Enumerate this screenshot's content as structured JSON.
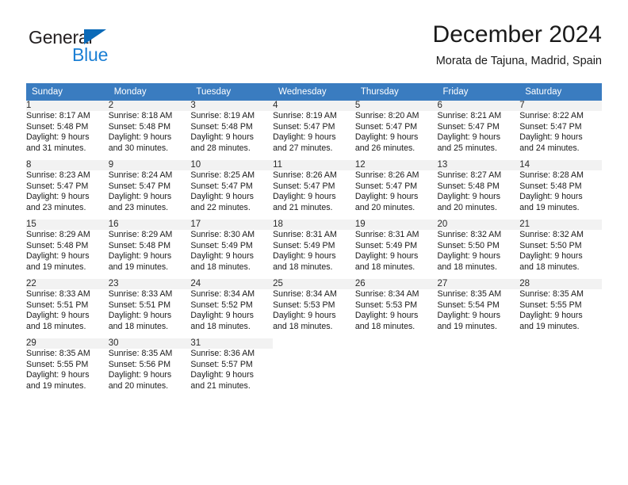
{
  "brand": {
    "name_part1": "General",
    "name_part2": "Blue",
    "triangle_color": "#0b6ab8",
    "blue_text_color": "#1b7fd4"
  },
  "header": {
    "title": "December 2024",
    "subtitle": "Morata de Tajuna, Madrid, Spain"
  },
  "theme": {
    "header_bg": "#3a7cc0",
    "header_text": "#ffffff",
    "daynum_bg": "#f2f2f2",
    "cell_bg": "#ffffff",
    "text": "#1a1a1a"
  },
  "calendar": {
    "weekday_headers": [
      "Sunday",
      "Monday",
      "Tuesday",
      "Wednesday",
      "Thursday",
      "Friday",
      "Saturday"
    ],
    "weeks": [
      [
        {
          "day": "1",
          "sunrise": "Sunrise: 8:17 AM",
          "sunset": "Sunset: 5:48 PM",
          "daylight1": "Daylight: 9 hours",
          "daylight2": "and 31 minutes."
        },
        {
          "day": "2",
          "sunrise": "Sunrise: 8:18 AM",
          "sunset": "Sunset: 5:48 PM",
          "daylight1": "Daylight: 9 hours",
          "daylight2": "and 30 minutes."
        },
        {
          "day": "3",
          "sunrise": "Sunrise: 8:19 AM",
          "sunset": "Sunset: 5:48 PM",
          "daylight1": "Daylight: 9 hours",
          "daylight2": "and 28 minutes."
        },
        {
          "day": "4",
          "sunrise": "Sunrise: 8:19 AM",
          "sunset": "Sunset: 5:47 PM",
          "daylight1": "Daylight: 9 hours",
          "daylight2": "and 27 minutes."
        },
        {
          "day": "5",
          "sunrise": "Sunrise: 8:20 AM",
          "sunset": "Sunset: 5:47 PM",
          "daylight1": "Daylight: 9 hours",
          "daylight2": "and 26 minutes."
        },
        {
          "day": "6",
          "sunrise": "Sunrise: 8:21 AM",
          "sunset": "Sunset: 5:47 PM",
          "daylight1": "Daylight: 9 hours",
          "daylight2": "and 25 minutes."
        },
        {
          "day": "7",
          "sunrise": "Sunrise: 8:22 AM",
          "sunset": "Sunset: 5:47 PM",
          "daylight1": "Daylight: 9 hours",
          "daylight2": "and 24 minutes."
        }
      ],
      [
        {
          "day": "8",
          "sunrise": "Sunrise: 8:23 AM",
          "sunset": "Sunset: 5:47 PM",
          "daylight1": "Daylight: 9 hours",
          "daylight2": "and 23 minutes."
        },
        {
          "day": "9",
          "sunrise": "Sunrise: 8:24 AM",
          "sunset": "Sunset: 5:47 PM",
          "daylight1": "Daylight: 9 hours",
          "daylight2": "and 23 minutes."
        },
        {
          "day": "10",
          "sunrise": "Sunrise: 8:25 AM",
          "sunset": "Sunset: 5:47 PM",
          "daylight1": "Daylight: 9 hours",
          "daylight2": "and 22 minutes."
        },
        {
          "day": "11",
          "sunrise": "Sunrise: 8:26 AM",
          "sunset": "Sunset: 5:47 PM",
          "daylight1": "Daylight: 9 hours",
          "daylight2": "and 21 minutes."
        },
        {
          "day": "12",
          "sunrise": "Sunrise: 8:26 AM",
          "sunset": "Sunset: 5:47 PM",
          "daylight1": "Daylight: 9 hours",
          "daylight2": "and 20 minutes."
        },
        {
          "day": "13",
          "sunrise": "Sunrise: 8:27 AM",
          "sunset": "Sunset: 5:48 PM",
          "daylight1": "Daylight: 9 hours",
          "daylight2": "and 20 minutes."
        },
        {
          "day": "14",
          "sunrise": "Sunrise: 8:28 AM",
          "sunset": "Sunset: 5:48 PM",
          "daylight1": "Daylight: 9 hours",
          "daylight2": "and 19 minutes."
        }
      ],
      [
        {
          "day": "15",
          "sunrise": "Sunrise: 8:29 AM",
          "sunset": "Sunset: 5:48 PM",
          "daylight1": "Daylight: 9 hours",
          "daylight2": "and 19 minutes."
        },
        {
          "day": "16",
          "sunrise": "Sunrise: 8:29 AM",
          "sunset": "Sunset: 5:48 PM",
          "daylight1": "Daylight: 9 hours",
          "daylight2": "and 19 minutes."
        },
        {
          "day": "17",
          "sunrise": "Sunrise: 8:30 AM",
          "sunset": "Sunset: 5:49 PM",
          "daylight1": "Daylight: 9 hours",
          "daylight2": "and 18 minutes."
        },
        {
          "day": "18",
          "sunrise": "Sunrise: 8:31 AM",
          "sunset": "Sunset: 5:49 PM",
          "daylight1": "Daylight: 9 hours",
          "daylight2": "and 18 minutes."
        },
        {
          "day": "19",
          "sunrise": "Sunrise: 8:31 AM",
          "sunset": "Sunset: 5:49 PM",
          "daylight1": "Daylight: 9 hours",
          "daylight2": "and 18 minutes."
        },
        {
          "day": "20",
          "sunrise": "Sunrise: 8:32 AM",
          "sunset": "Sunset: 5:50 PM",
          "daylight1": "Daylight: 9 hours",
          "daylight2": "and 18 minutes."
        },
        {
          "day": "21",
          "sunrise": "Sunrise: 8:32 AM",
          "sunset": "Sunset: 5:50 PM",
          "daylight1": "Daylight: 9 hours",
          "daylight2": "and 18 minutes."
        }
      ],
      [
        {
          "day": "22",
          "sunrise": "Sunrise: 8:33 AM",
          "sunset": "Sunset: 5:51 PM",
          "daylight1": "Daylight: 9 hours",
          "daylight2": "and 18 minutes."
        },
        {
          "day": "23",
          "sunrise": "Sunrise: 8:33 AM",
          "sunset": "Sunset: 5:51 PM",
          "daylight1": "Daylight: 9 hours",
          "daylight2": "and 18 minutes."
        },
        {
          "day": "24",
          "sunrise": "Sunrise: 8:34 AM",
          "sunset": "Sunset: 5:52 PM",
          "daylight1": "Daylight: 9 hours",
          "daylight2": "and 18 minutes."
        },
        {
          "day": "25",
          "sunrise": "Sunrise: 8:34 AM",
          "sunset": "Sunset: 5:53 PM",
          "daylight1": "Daylight: 9 hours",
          "daylight2": "and 18 minutes."
        },
        {
          "day": "26",
          "sunrise": "Sunrise: 8:34 AM",
          "sunset": "Sunset: 5:53 PM",
          "daylight1": "Daylight: 9 hours",
          "daylight2": "and 18 minutes."
        },
        {
          "day": "27",
          "sunrise": "Sunrise: 8:35 AM",
          "sunset": "Sunset: 5:54 PM",
          "daylight1": "Daylight: 9 hours",
          "daylight2": "and 19 minutes."
        },
        {
          "day": "28",
          "sunrise": "Sunrise: 8:35 AM",
          "sunset": "Sunset: 5:55 PM",
          "daylight1": "Daylight: 9 hours",
          "daylight2": "and 19 minutes."
        }
      ],
      [
        {
          "day": "29",
          "sunrise": "Sunrise: 8:35 AM",
          "sunset": "Sunset: 5:55 PM",
          "daylight1": "Daylight: 9 hours",
          "daylight2": "and 19 minutes."
        },
        {
          "day": "30",
          "sunrise": "Sunrise: 8:35 AM",
          "sunset": "Sunset: 5:56 PM",
          "daylight1": "Daylight: 9 hours",
          "daylight2": "and 20 minutes."
        },
        {
          "day": "31",
          "sunrise": "Sunrise: 8:36 AM",
          "sunset": "Sunset: 5:57 PM",
          "daylight1": "Daylight: 9 hours",
          "daylight2": "and 21 minutes."
        },
        {
          "day": "",
          "sunrise": "",
          "sunset": "",
          "daylight1": "",
          "daylight2": ""
        },
        {
          "day": "",
          "sunrise": "",
          "sunset": "",
          "daylight1": "",
          "daylight2": ""
        },
        {
          "day": "",
          "sunrise": "",
          "sunset": "",
          "daylight1": "",
          "daylight2": ""
        },
        {
          "day": "",
          "sunrise": "",
          "sunset": "",
          "daylight1": "",
          "daylight2": ""
        }
      ]
    ]
  }
}
